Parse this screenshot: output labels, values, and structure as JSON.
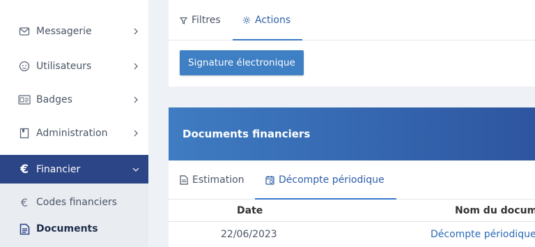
{
  "sidebar": {
    "items": [
      {
        "label": "Messagerie",
        "icon": "mail-icon"
      },
      {
        "label": "Utilisateurs",
        "icon": "user-face-icon"
      },
      {
        "label": "Badges",
        "icon": "badge-icon"
      },
      {
        "label": "Administration",
        "icon": "book-icon"
      },
      {
        "label": "Financier",
        "icon": "euro-icon"
      }
    ],
    "submenu": [
      {
        "label": "Codes financiers",
        "icon": "euro-icon"
      },
      {
        "label": "Documents",
        "icon": "document-icon"
      }
    ]
  },
  "top_tabs": [
    {
      "label": "Filtres",
      "icon": "filter-icon"
    },
    {
      "label": "Actions",
      "icon": "gear-icon"
    }
  ],
  "signature_button": "Signature électronique",
  "docs": {
    "title": "Documents financiers",
    "tabs": [
      {
        "label": "Estimation",
        "icon": "file-icon"
      },
      {
        "label": "Décompte périodique",
        "icon": "calendar-icon"
      }
    ],
    "columns": [
      "Date",
      "Nom du document"
    ],
    "rows": [
      {
        "date": "22/06/2023",
        "name": "Décompte périodique"
      }
    ]
  },
  "colors": {
    "accent": "#2c4586",
    "header_gradient_start": "#3f7cc2",
    "link": "#2c6ab8",
    "button": "#3f7fc4"
  }
}
